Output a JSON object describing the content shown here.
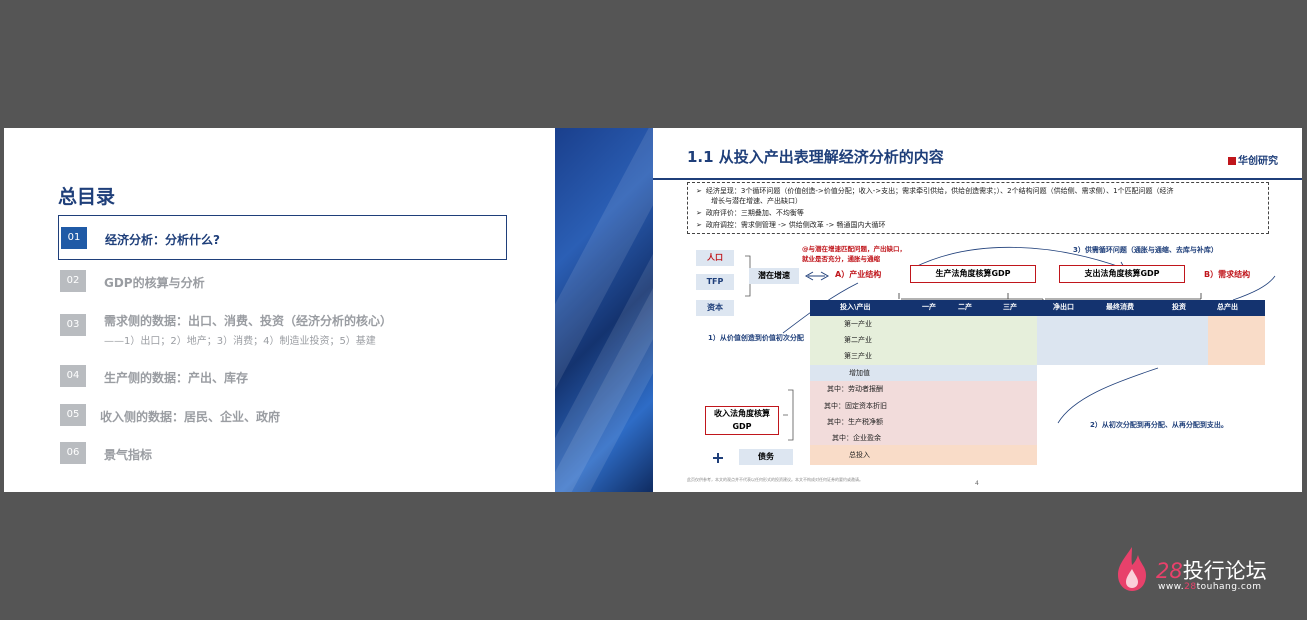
{
  "left_slide": {
    "title": "总目录",
    "items": [
      {
        "num": "01",
        "text": "经济分析：分析什么?",
        "sub": ""
      },
      {
        "num": "02",
        "text": "GDP的核算与分析",
        "sub": ""
      },
      {
        "num": "03",
        "text": "需求侧的数据：出口、消费、投资（经济分析的核心）",
        "sub": "——1）出口；2）地产；3）消费；4）制造业投资；5）基建"
      },
      {
        "num": "04",
        "text": "生产侧的数据：产出、库存",
        "sub": ""
      },
      {
        "num": "05",
        "text": "收入侧的数据：居民、企业、政府",
        "sub": ""
      },
      {
        "num": "06",
        "text": "景气指标",
        "sub": ""
      }
    ],
    "active_index": 0
  },
  "right_slide": {
    "title": "1.1 从投入产出表理解经济分析的内容",
    "logo": "华创研究",
    "bullets": [
      "经济呈现：3个循环问题（价值创造->价值分配；收入->支出；需求牵引供给，供给创造需求；）、2个结构问题（供给侧、需求侧）、1个匹配问题（经济",
      "增长与潜在增速、产出缺口）",
      "政府评价：三期叠加、不均衡等",
      "政府调控：需求侧管理 -> 供给侧改革 -> 畅通国内大循环"
    ],
    "factors": [
      "人口",
      "TFP",
      "资本"
    ],
    "potential_growth": "潜在增速",
    "note_a": "@与潜在增速匹配问题，产出缺口，",
    "note_a2": "就业是否充分，通胀与通缩",
    "label_a": "A）产业结构",
    "box_production": "生产法角度核算GDP",
    "box_expenditure": "支出法角度核算GDP",
    "note_3": "3）供需循环问题（通胀与通缩、去库与补库）",
    "label_b": "B）需求结构",
    "table_headers": [
      "投入\\产出",
      "一产",
      "二产",
      "三产",
      "净出口",
      "最终消费",
      "投资",
      "总产出"
    ],
    "rows": [
      "第一产业",
      "第二产业",
      "第三产业",
      "增加值",
      "其中：劳动者报酬",
      "其中：固定资本折旧",
      "其中：生产税净额",
      "其中：企业盈余",
      "总投入"
    ],
    "note_1": "1）从价值创造到价值初次分配",
    "box_income": "收入法角度核算GDP",
    "note_2": "2）从初次分配到再分配、从再分配到支出。",
    "debt": "债务",
    "footnote": "此页仅供参考，本文的观点并不代表以任何形式的投资建议。本文不构成对任何证券的要约或邀请。",
    "page_num": "4"
  },
  "watermark": {
    "num": "28",
    "text": "投行论坛",
    "url_prefix": "www.",
    "url_hl": "28",
    "url_suffix": "touhang.com"
  }
}
